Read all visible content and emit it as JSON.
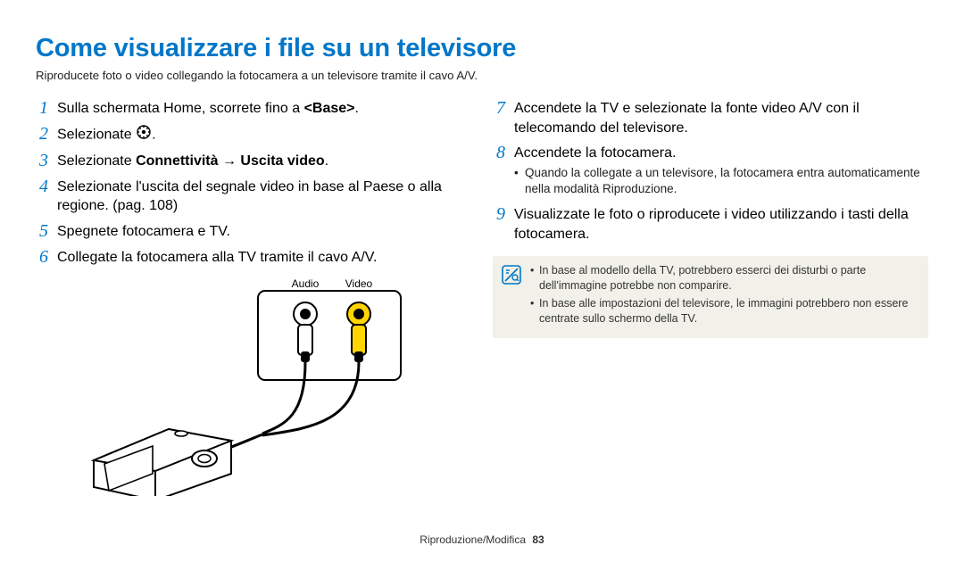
{
  "title": "Come visualizzare i file su un televisore",
  "subtitle": "Riproducete foto o video collegando la fotocamera a un televisore tramite il cavo A/V.",
  "left": {
    "steps": [
      {
        "num": "1",
        "pre": "Sulla schermata Home, scorrete fino a ",
        "bold": "<Base>",
        "post": "."
      },
      {
        "num": "2",
        "pre": "Selezionate ",
        "has_icon": true,
        "post": "."
      },
      {
        "num": "3",
        "pre": "Selezionate ",
        "bold": "Connettività → Uscita video",
        "post": "."
      },
      {
        "num": "4",
        "pre": "Selezionate l'uscita del segnale video in base al Paese o alla regione. (pag. 108)"
      },
      {
        "num": "5",
        "pre": "Spegnete fotocamera e TV."
      },
      {
        "num": "6",
        "pre": "Collegate la fotocamera alla TV tramite il cavo A/V."
      }
    ]
  },
  "right": {
    "steps": [
      {
        "num": "7",
        "pre": "Accendete la TV e selezionate la fonte video A/V con il telecomando del televisore."
      },
      {
        "num": "8",
        "pre": "Accendete la fotocamera.",
        "bullets": [
          "Quando la collegate a un televisore, la fotocamera entra automaticamente nella modalità Riproduzione."
        ]
      },
      {
        "num": "9",
        "pre": "Visualizzate le foto o riproducete i video utilizzando i tasti della fotocamera."
      }
    ],
    "notes": [
      "In base al modello della TV, potrebbero esserci dei disturbi o parte dell'immagine potrebbe non comparire.",
      "In base alle impostazioni del televisore, le immagini potrebbero non essere centrate sullo schermo della TV."
    ]
  },
  "diagram": {
    "audio_label": "Audio",
    "video_label": "Video"
  },
  "footer": {
    "section": "Riproduzione/Modifica",
    "page": "83"
  }
}
